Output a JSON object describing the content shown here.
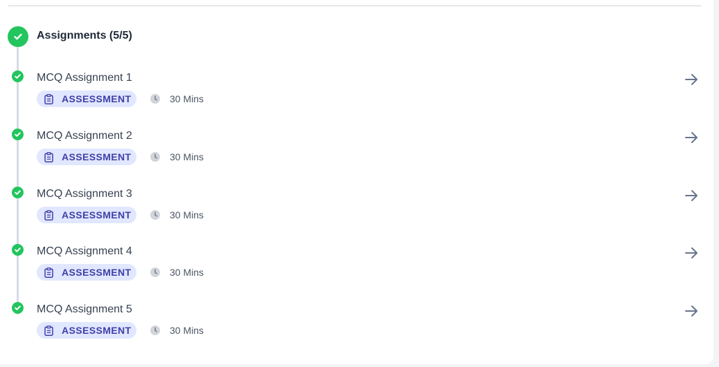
{
  "section": {
    "title": "Assignments (5/5)",
    "status_icon": "check-circle-icon",
    "accent_color": "#22c55e"
  },
  "items": [
    {
      "title": "MCQ Assignment 1",
      "badge": "ASSESSMENT",
      "duration": "30 Mins"
    },
    {
      "title": "MCQ Assignment 2",
      "badge": "ASSESSMENT",
      "duration": "30 Mins"
    },
    {
      "title": "MCQ Assignment 3",
      "badge": "ASSESSMENT",
      "duration": "30 Mins"
    },
    {
      "title": "MCQ Assignment 4",
      "badge": "ASSESSMENT",
      "duration": "30 Mins"
    },
    {
      "title": "MCQ Assignment 5",
      "badge": "ASSESSMENT",
      "duration": "30 Mins"
    }
  ],
  "icons": {
    "item_status": "check-circle-icon",
    "badge": "clipboard-icon",
    "duration": "clock-icon",
    "open": "arrow-right-icon"
  },
  "colors": {
    "badge_bg": "#e0e7ff",
    "badge_text": "#3f3fa8",
    "arrow": "#64748b"
  }
}
